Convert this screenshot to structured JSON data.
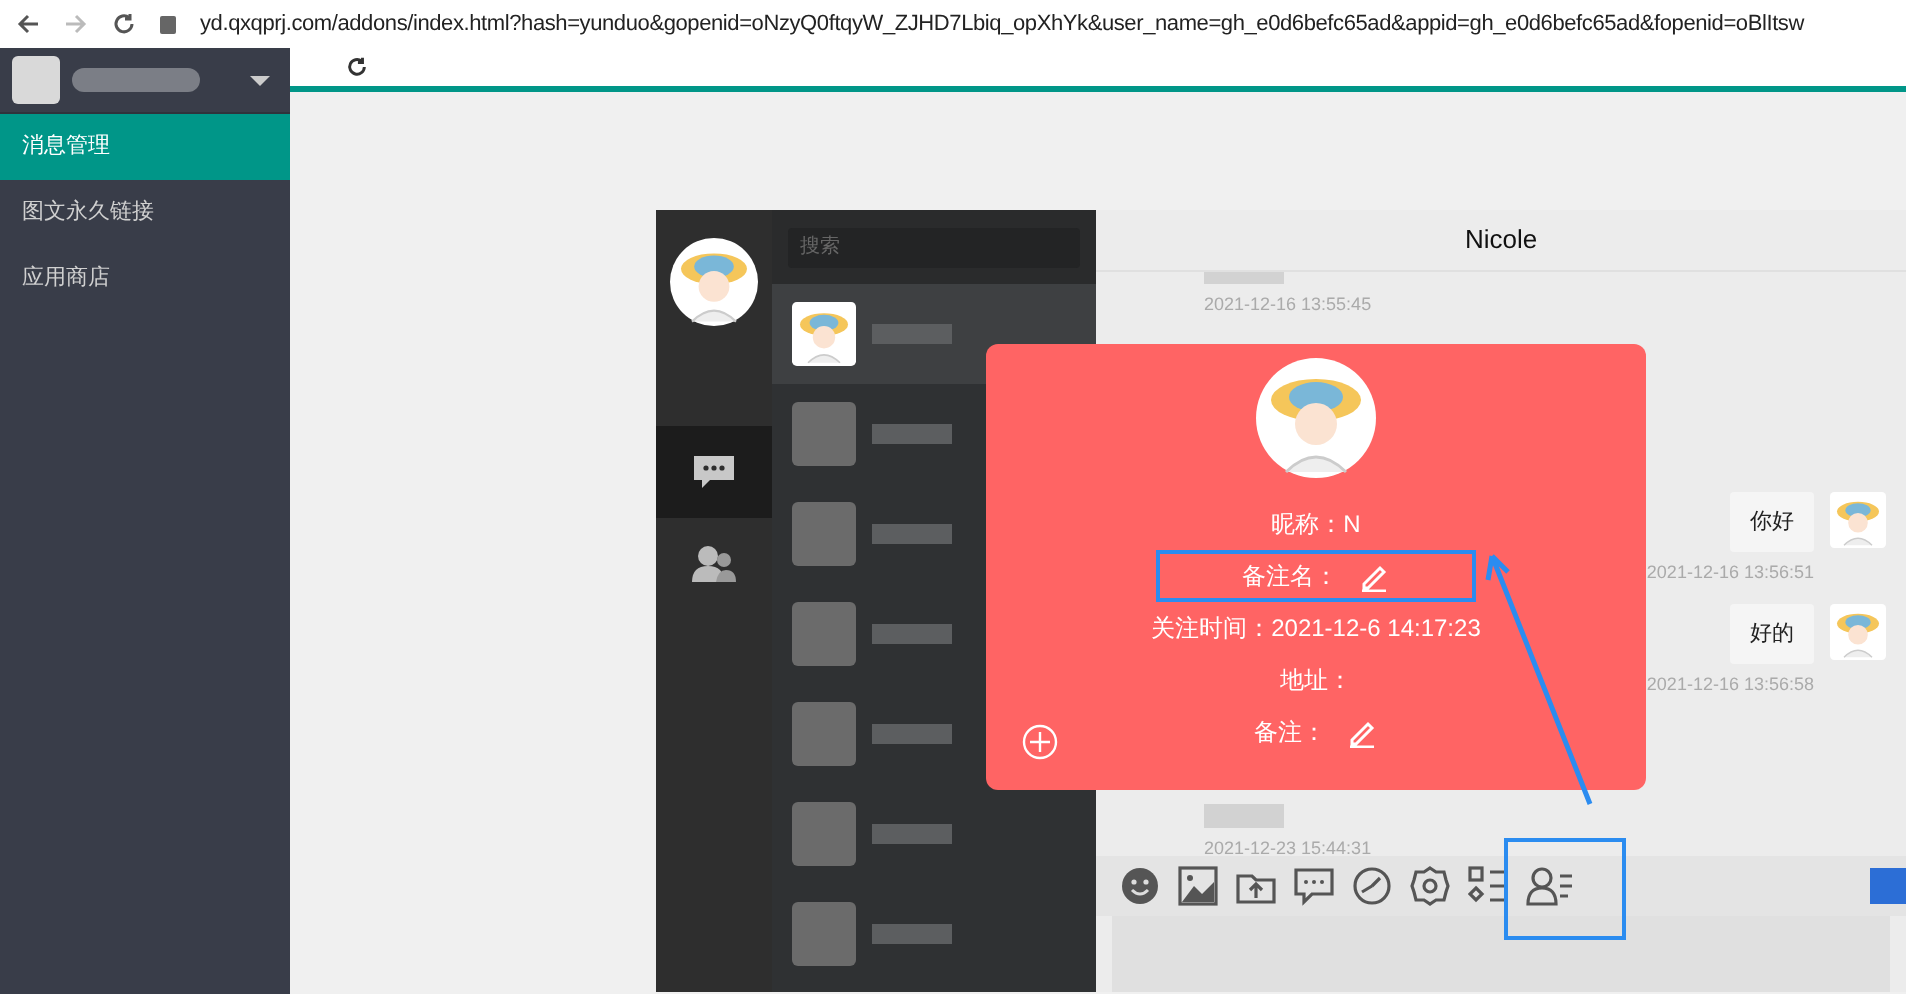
{
  "browser": {
    "url": "yd.qxqprj.com/addons/index.html?hash=yunduo&gopenid=oNzyQ0ftqyW_ZJHD7Lbiq_opXhYk&user_name=gh_e0d6befc65ad&appid=gh_e0d6befc65ad&fopenid=oBlItsw"
  },
  "sidebar": {
    "items": [
      {
        "label": "消息管理",
        "selected": true
      },
      {
        "label": "图文永久链接",
        "selected": false
      },
      {
        "label": "应用商店",
        "selected": false
      }
    ]
  },
  "chat": {
    "search": {
      "placeholder": "搜索"
    },
    "nav": [
      {
        "kind": "chat",
        "selected": true
      },
      {
        "kind": "contacts",
        "selected": false
      }
    ],
    "contacts": [
      {
        "selected": true
      },
      {
        "selected": false
      },
      {
        "selected": false
      },
      {
        "selected": false
      },
      {
        "selected": false
      },
      {
        "selected": false
      },
      {
        "selected": false
      }
    ],
    "title": "Nicole",
    "messages": [
      {
        "kind": "incoming",
        "time": "2021-12-16 13:55:45"
      },
      {
        "kind": "outgoing",
        "text": "你好",
        "time": "2021-12-16 13:56:51"
      },
      {
        "kind": "outgoing",
        "text": "好的",
        "time": "2021-12-16 13:56:58"
      },
      {
        "kind": "incoming",
        "time": "2021-12-23 15:44:31"
      }
    ]
  },
  "profile": {
    "fields": [
      {
        "label": "昵称：",
        "value": "N",
        "editable": false,
        "highlighted": false
      },
      {
        "label": "备注名：",
        "editable": true,
        "highlighted": true
      },
      {
        "label": "关注时间：",
        "value": "2021-12-6 14:17:23",
        "editable": false,
        "highlighted": false
      },
      {
        "label": "地址：",
        "editable": false,
        "highlighted": false
      },
      {
        "label": "备注：",
        "editable": true,
        "highlighted": false
      }
    ]
  }
}
